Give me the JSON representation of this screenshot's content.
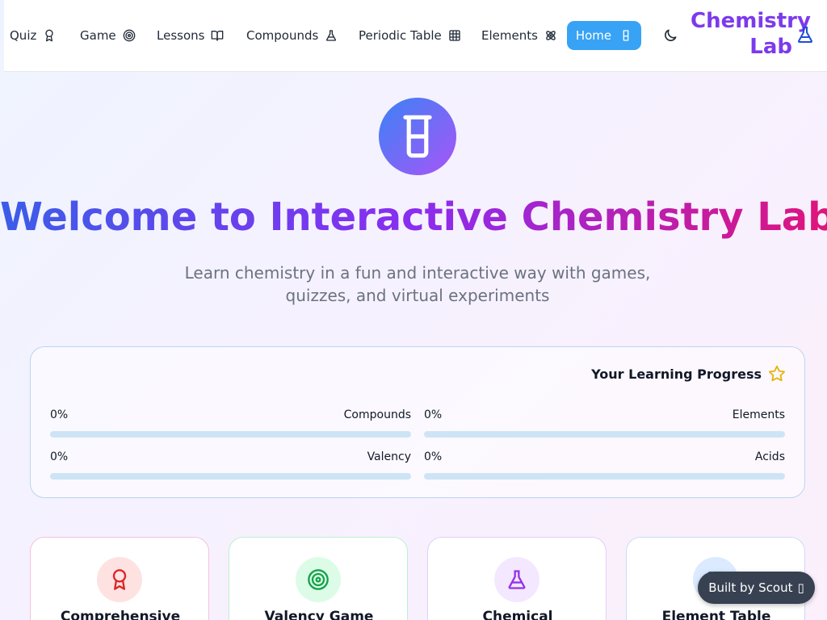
{
  "nav": {
    "items": [
      {
        "label": "Quiz",
        "icon": "award-icon"
      },
      {
        "label": "Game",
        "icon": "target-icon"
      },
      {
        "label": "Lessons",
        "icon": "book-open-icon"
      },
      {
        "label": "Compounds",
        "icon": "flask-icon"
      },
      {
        "label": "Periodic Table",
        "icon": "grid-icon"
      },
      {
        "label": "Elements",
        "icon": "atom-icon"
      }
    ],
    "home_label": "Home",
    "home_icon": "beaker-icon",
    "theme_icon": "moon-icon",
    "brand": "Chemistry Lab",
    "brand_icon": "flask-icon"
  },
  "hero": {
    "icon": "beaker-icon",
    "title": "Welcome to Interactive Chemistry Lab",
    "subtitle": "Learn chemistry in a fun and interactive way with games, quizzes, and virtual experiments"
  },
  "progress": {
    "title": "Your Learning Progress",
    "icon": "star-icon",
    "items": [
      {
        "name": "Compounds",
        "pct_label": "0%",
        "value": 0
      },
      {
        "name": "Elements",
        "pct_label": "0%",
        "value": 0
      },
      {
        "name": "Valency",
        "pct_label": "0%",
        "value": 0
      },
      {
        "name": "Acids",
        "pct_label": "0%",
        "value": 0
      }
    ]
  },
  "features": [
    {
      "title": "Comprehensive",
      "icon": "award-icon",
      "color": "#dc2626"
    },
    {
      "title": "Valency Game",
      "icon": "target-icon",
      "color": "#16a34a"
    },
    {
      "title": "Chemical",
      "icon": "flask-icon",
      "color": "#9333ea"
    },
    {
      "title": "Element Table",
      "icon": "atom-icon",
      "color": "#2563eb"
    }
  ],
  "scout": {
    "label": "Built by Scout",
    "glyph": "▯"
  },
  "colors": {
    "accent": "#38a3f5",
    "brand": "#7c3aed"
  }
}
